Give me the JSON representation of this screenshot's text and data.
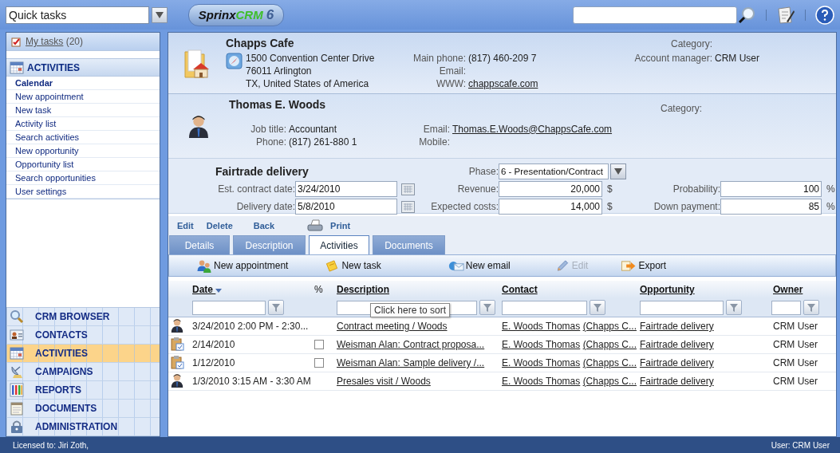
{
  "quick_tasks": {
    "value": "Quick tasks"
  },
  "logo": {
    "name": "Sprinx",
    "highlight": "CRM",
    "version": "6"
  },
  "sidebar": {
    "my_tasks": {
      "label": "My tasks",
      "count": "(20)"
    },
    "section": {
      "title": "ACTIVITIES",
      "items": [
        {
          "label": "Calendar",
          "selected": true
        },
        {
          "label": "New appointment",
          "selected": false
        },
        {
          "label": "New task",
          "selected": false
        },
        {
          "label": "Activity list",
          "selected": false
        },
        {
          "label": "Search activities",
          "selected": false
        },
        {
          "label": "New opportunity",
          "selected": false
        },
        {
          "label": "Opportunity list",
          "selected": false
        },
        {
          "label": "Search opportunities",
          "selected": false
        },
        {
          "label": "User settings",
          "selected": false
        }
      ]
    },
    "modules": [
      {
        "label": "CRM BROWSER",
        "kind": "browser",
        "selected": false
      },
      {
        "label": "CONTACTS",
        "kind": "contacts",
        "selected": false
      },
      {
        "label": "ACTIVITIES",
        "kind": "activities",
        "selected": true
      },
      {
        "label": "CAMPAIGNS",
        "kind": "campaigns",
        "selected": false
      },
      {
        "label": "REPORTS",
        "kind": "reports",
        "selected": false
      },
      {
        "label": "DOCUMENTS",
        "kind": "documents",
        "selected": false
      },
      {
        "label": "ADMINISTRATION",
        "kind": "administration",
        "selected": false
      }
    ]
  },
  "account": {
    "name": "Chapps Cafe",
    "address": [
      "1500 Convention Center Drive",
      "76011 Arlington",
      "TX, United States of America"
    ],
    "fields": [
      {
        "label": "Main phone:",
        "value": "(817) 460-209 7",
        "link": false
      },
      {
        "label": "Email:"
      },
      {
        "label": "WWW:",
        "value": "chappscafe.com",
        "link": true
      }
    ],
    "category": {
      "label": "Category:"
    },
    "manager": {
      "label": "Account manager:",
      "value": "CRM User"
    }
  },
  "contact": {
    "name": "Thomas E. Woods",
    "fields": [
      {
        "label": "Job title:",
        "value": "Accountant",
        "link": false
      },
      {
        "label": "Phone:",
        "value": "(817) 261-880 1",
        "link": false
      }
    ],
    "fields2": [
      {
        "label": "Email:",
        "value": "Thomas.E.Woods@ChappsCafe.com",
        "link": true
      },
      {
        "label": "Mobile:"
      }
    ],
    "category": {
      "label": "Category:"
    }
  },
  "opportunity": {
    "title": "Fairtrade delivery",
    "phase": {
      "label": "Phase:",
      "value": "6 - Presentation/Contract"
    },
    "rows": [
      [
        {
          "label": "Est. contract date:",
          "value": "3/24/2010",
          "kind": "date"
        },
        {
          "label": "Revenue:",
          "value": "20,000",
          "kind": "amount",
          "unit": "$"
        },
        {
          "label": "Probability:",
          "value": "100",
          "kind": "amount",
          "unit": "%"
        }
      ],
      [
        {
          "label": "Delivery date:",
          "value": "5/8/2010",
          "kind": "date"
        },
        {
          "label": "Expected costs:",
          "value": "14,000",
          "kind": "amount",
          "unit": "$"
        },
        {
          "label": "Down payment:",
          "value": "85",
          "kind": "amount",
          "unit": "%"
        }
      ]
    ]
  },
  "actions": [
    {
      "label": "Edit",
      "kind": "plain"
    },
    {
      "label": "Delete",
      "kind": "plain"
    },
    {
      "label": "Back",
      "kind": "plain"
    },
    {
      "label": "Print",
      "kind": "print"
    }
  ],
  "tabs": [
    {
      "label": "Details",
      "selected": false
    },
    {
      "label": "Description",
      "selected": false
    },
    {
      "label": "Activities",
      "selected": true
    },
    {
      "label": "Documents",
      "selected": false
    }
  ],
  "toolbar": [
    {
      "label": "New appointment",
      "kind": "appointment",
      "disabled": false
    },
    {
      "label": "New task",
      "kind": "task",
      "disabled": false
    },
    {
      "label": "New email",
      "kind": "email",
      "disabled": false
    },
    {
      "label": "Edit",
      "kind": "edit",
      "disabled": true
    },
    {
      "label": "Export",
      "kind": "export",
      "disabled": false
    }
  ],
  "table": {
    "columns": [
      {
        "label": "Date",
        "sorted": true,
        "filter": true
      },
      {
        "label": "%",
        "sorted": false,
        "filter": false
      },
      {
        "label": "Description",
        "sorted": false,
        "filter": true
      },
      {
        "label": "Contact",
        "sorted": false,
        "filter": true
      },
      {
        "label": "Opportunity",
        "sorted": false,
        "filter": true
      },
      {
        "label": "Owner",
        "sorted": false,
        "filter": true
      }
    ],
    "tooltip": "Click here to sort",
    "rows": [
      {
        "kind": "appointment",
        "date": "3/24/2010 2:00 PM - 2:30...",
        "description": "Contract meeting / Woods",
        "contact": "E. Woods Thomas",
        "company": "(Chapps C...",
        "opportunity": "Fairtrade delivery",
        "owner": "CRM User"
      },
      {
        "kind": "task",
        "checked": false,
        "date": "2/14/2010",
        "description": "Weisman Alan: Contract proposa...",
        "contact": "E. Woods Thomas",
        "company": "(Chapps C...",
        "opportunity": "Fairtrade delivery",
        "owner": "CRM User"
      },
      {
        "kind": "task",
        "checked": false,
        "date": "1/12/2010",
        "description": "Weisman Alan: Sample delivery /...",
        "contact": "E. Woods Thomas",
        "company": "(Chapps C...",
        "opportunity": "Fairtrade delivery",
        "owner": "CRM User"
      },
      {
        "kind": "appointment",
        "date": "1/3/2010 3:15 AM - 3:30 AM",
        "description": "Presales visit / Woods",
        "contact": "E. Woods Thomas",
        "company": "(Chapps C...",
        "opportunity": "Fairtrade delivery",
        "owner": "CRM User"
      }
    ]
  },
  "status_bar": {
    "left": "Licensed to: Jiri Zoth,",
    "right": "User: CRM User"
  }
}
